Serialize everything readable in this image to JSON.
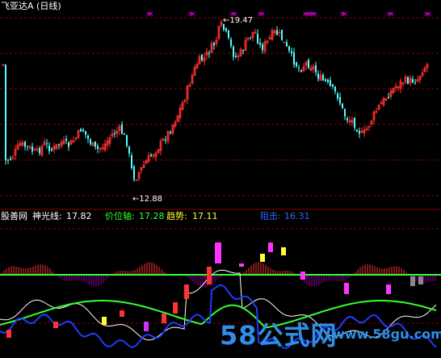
{
  "upper_panel": {
    "title": "飞亚达A (日线)",
    "high_marker": "←19.47",
    "low_marker": "←12.88",
    "colors": {
      "up": "#ff3030",
      "down": "#54ffff",
      "grid": "#8b0000",
      "signal": "#ff00ff"
    }
  },
  "indicator_bar": {
    "name": "股善网",
    "items": [
      {
        "label": "神光线:",
        "value": "17.82",
        "color": "#ffffff"
      },
      {
        "label": "价位轴:",
        "value": "17.28",
        "color": "#33ff33"
      },
      {
        "label": "趋势:",
        "value": "17.11",
        "color": "#ffff33"
      },
      {
        "label": "阻击:",
        "value": "16.31",
        "color": "#3366ff"
      }
    ]
  },
  "lower_panel": {
    "colors": {
      "white_line": "#ffffff",
      "green_line": "#33ff33",
      "blue_line": "#1d3cff",
      "bars_up": "#ff3333",
      "bars_down": "#9900aa"
    }
  },
  "watermark": {
    "text": "58公式网",
    "url": "www.58gu.com"
  }
}
